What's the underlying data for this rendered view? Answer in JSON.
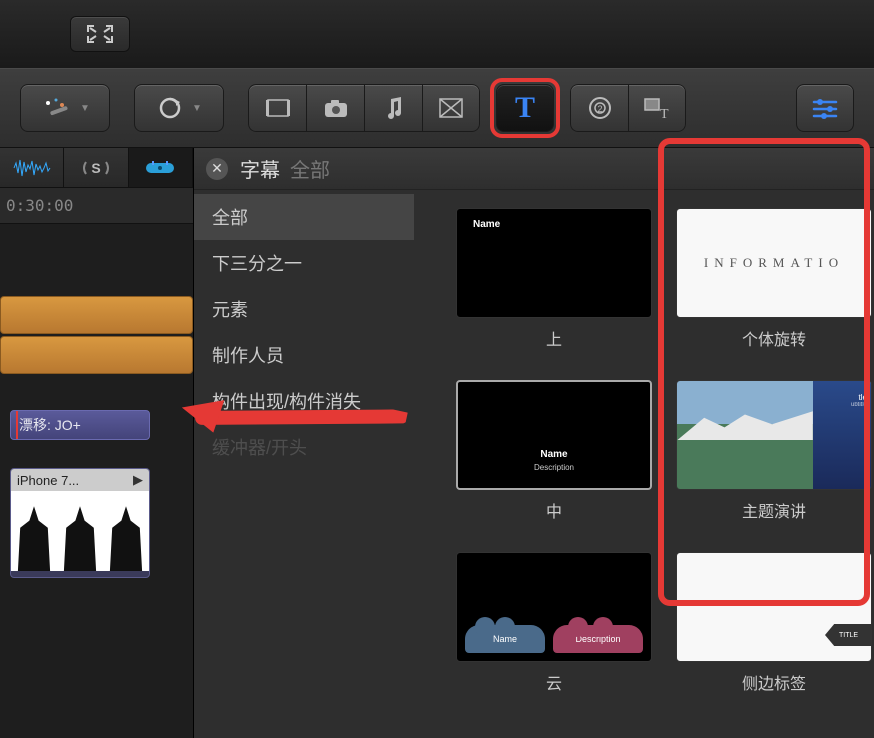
{
  "toolbar": {
    "magic_wand": "magic-wand",
    "retime": "retime",
    "clips_icon": "clips",
    "camera_icon": "camera",
    "music_icon": "music",
    "transitions_icon": "transitions",
    "text_icon": "T",
    "generators_icon": "generators",
    "themes_icon": "themes",
    "inspector_icon": "inspector"
  },
  "audio_tabs": {
    "waveform": "waveform",
    "surround": "S",
    "tag": "tag"
  },
  "timecode": "0:30:00",
  "clips": {
    "drift_label": "漂移: JO+",
    "video_label": "iPhone 7..."
  },
  "browser": {
    "title": "字幕",
    "subtitle": "全部",
    "categories": [
      "全部",
      "下三分之一",
      "元素",
      "制作人员",
      "构件出现/构件消失",
      "缓冲器/开头"
    ]
  },
  "titles": [
    {
      "label": "上",
      "thumb_text1": "Name"
    },
    {
      "label": "个体旋转",
      "thumb_text1": "INFORMATIO"
    },
    {
      "label": "中",
      "thumb_text1": "Name",
      "thumb_text2": "Description"
    },
    {
      "label": "主题演讲",
      "thumb_text1": "tle",
      "thumb_text2": "ubtitle"
    },
    {
      "label": "云",
      "thumb_text1": "Name",
      "thumb_text2": "Description"
    },
    {
      "label": "侧边标签",
      "thumb_text1": "TITLE"
    }
  ]
}
